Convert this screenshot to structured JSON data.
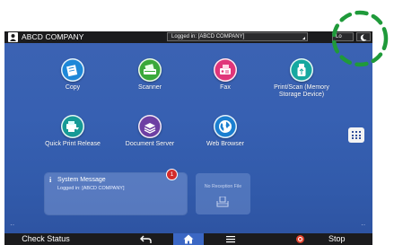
{
  "header": {
    "company_name": "ABCD COMPANY",
    "login_status": "Logged in: [ABCD COMPANY]",
    "login_button_label": "Lo"
  },
  "apps": [
    {
      "label": "Copy",
      "icon": "copy-icon",
      "color": "#1e88d8"
    },
    {
      "label": "Scanner",
      "icon": "scanner-icon",
      "color": "#3aa83a"
    },
    {
      "label": "Fax",
      "icon": "fax-icon",
      "color": "#e0357a"
    },
    {
      "label": "Print/Scan (Memory",
      "label2": "Storage Device)",
      "icon": "usb-icon",
      "color": "#16a8a0"
    },
    {
      "label": "Quick Print Release",
      "icon": "print-release-icon",
      "color": "#169a96"
    },
    {
      "label": "Document Server",
      "icon": "document-server-icon",
      "color": "#6e3fa3"
    },
    {
      "label": "Web Browser",
      "icon": "globe-icon",
      "color": "#1b7fd0"
    }
  ],
  "system_message": {
    "title": "System Message",
    "text": "Logged in: [ABCD COMPANY]",
    "badge_count": "1"
  },
  "reception": {
    "text": "No Reception File"
  },
  "footer": {
    "check_status": "Check Status",
    "stop": "Stop"
  },
  "colors": {
    "background": "#3760b2",
    "bar": "#1b1b1d",
    "highlight": "#1f9a3a",
    "home_active": "#3b67c4"
  }
}
